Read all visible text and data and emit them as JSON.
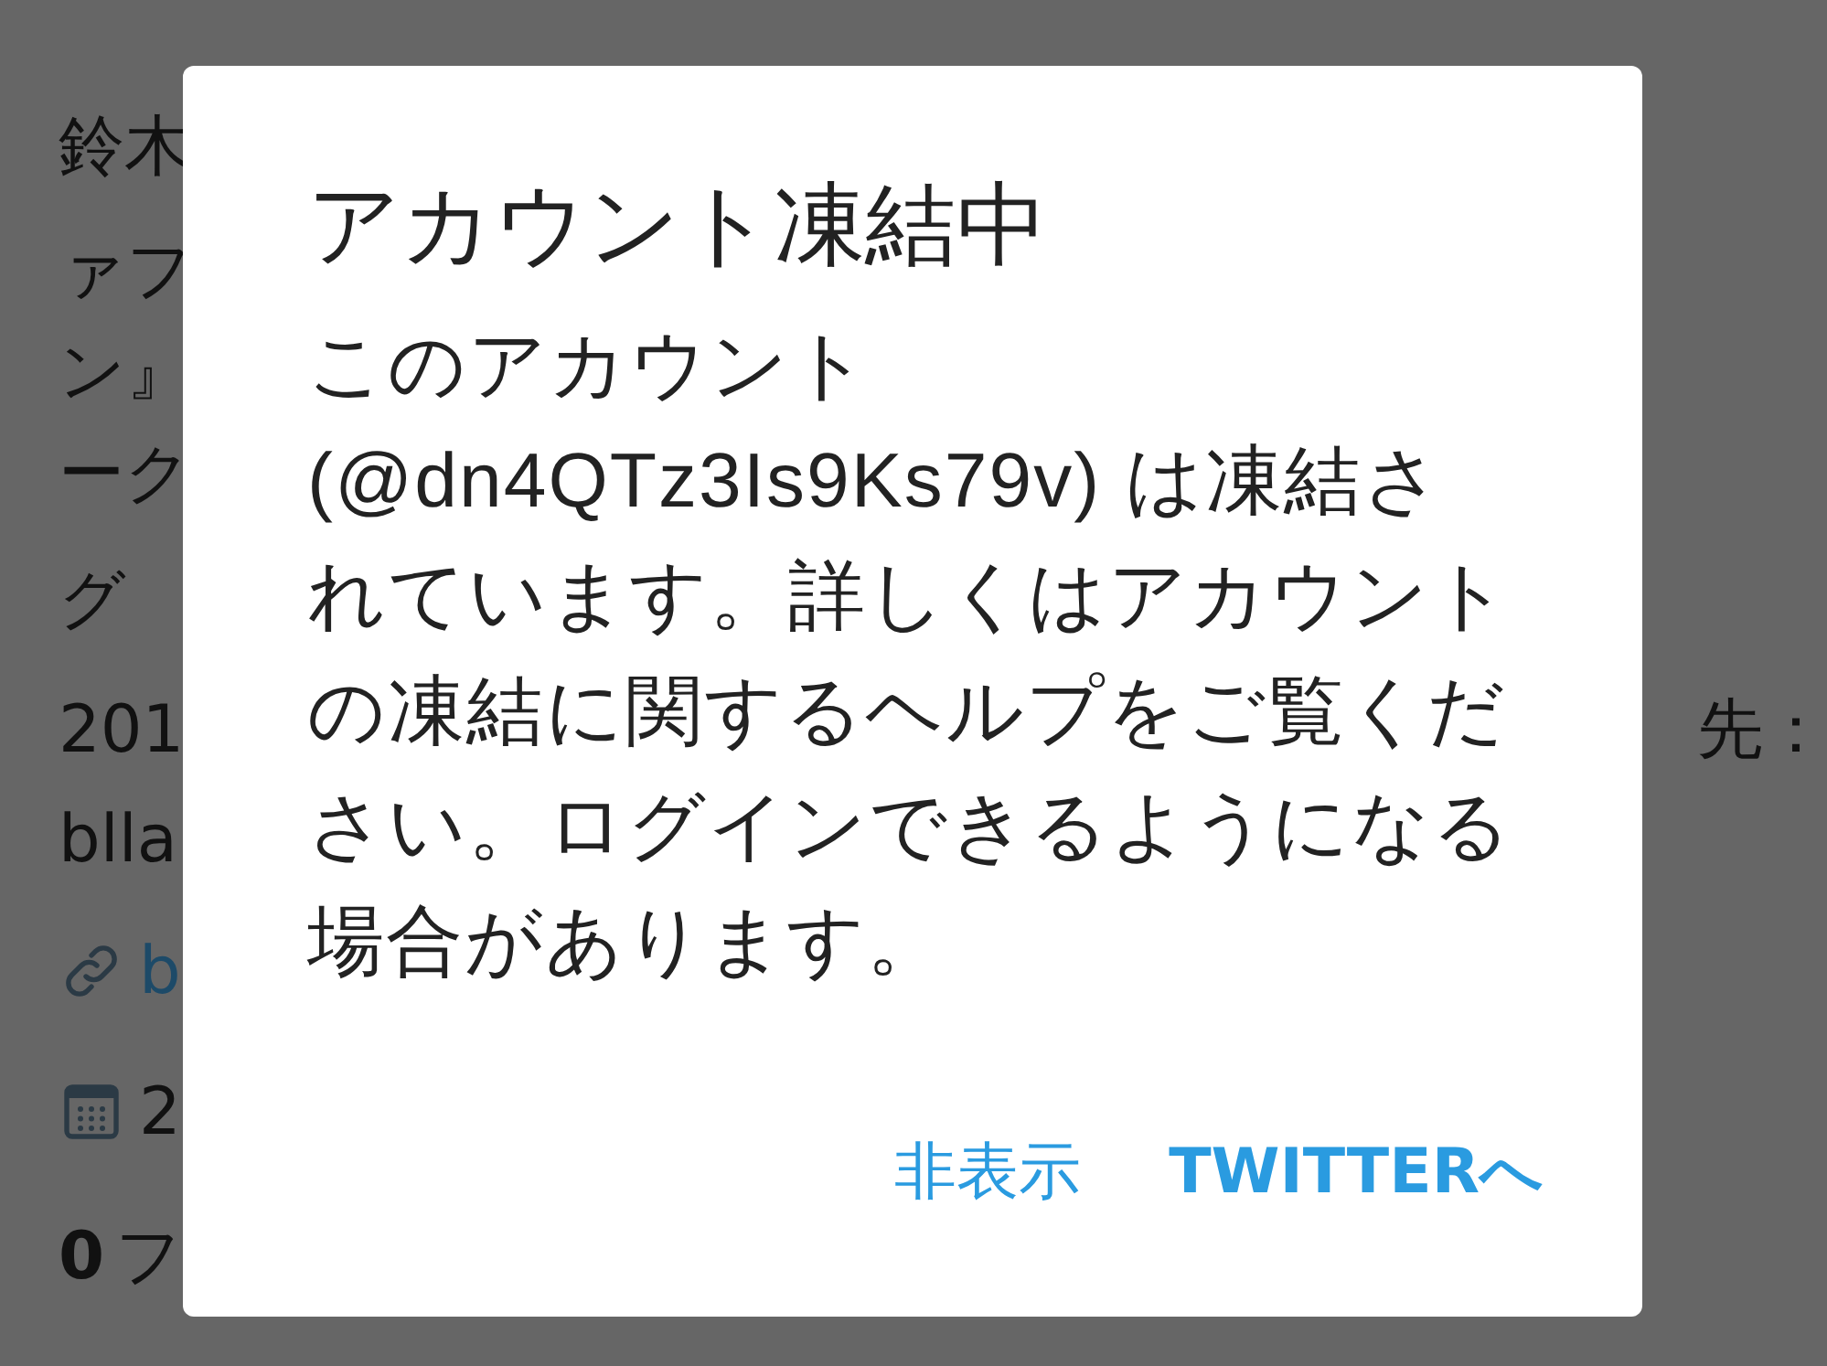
{
  "background_profile": {
    "lines": [
      {
        "kind": "text",
        "text": "鈴木"
      },
      {
        "kind": "text",
        "text": "ァフ"
      },
      {
        "kind": "text",
        "text": "ン』"
      },
      {
        "kind": "text",
        "text": "ーク"
      },
      {
        "kind": "text",
        "text": "グ"
      },
      {
        "kind": "text",
        "text": "201",
        "right_text": "先："
      },
      {
        "kind": "text",
        "text": "blla"
      },
      {
        "kind": "link",
        "text": "b"
      },
      {
        "kind": "date",
        "text": "2"
      },
      {
        "kind": "count",
        "count": "0",
        "text": "フ"
      }
    ]
  },
  "dialog": {
    "title": "アカウント凍結中",
    "message": "このアカウント (@dn4QTz3Is9Ks79v) は凍結されています。詳しくはアカウントの凍結に関するヘルプをご覧ください。ログインできるようになる場合があります。",
    "buttons": [
      {
        "label": "非表示",
        "kind": "plain"
      },
      {
        "label": "TWITTERへ",
        "kind": "primary"
      }
    ]
  }
}
